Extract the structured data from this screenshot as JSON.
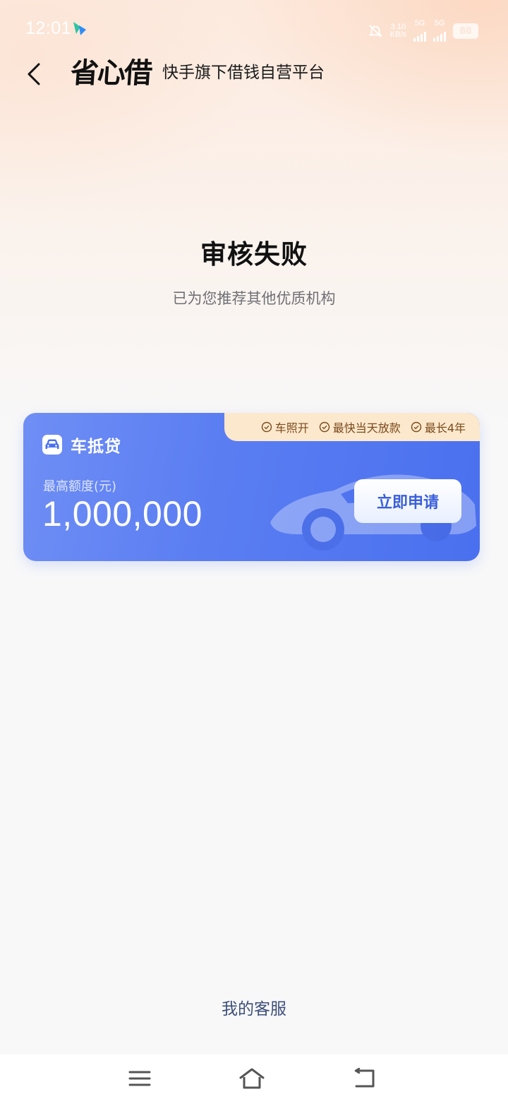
{
  "status_bar": {
    "time": "12:01",
    "network_top": "3.10",
    "network_bottom": "KB/s",
    "network_type": "5G",
    "battery": "88"
  },
  "header": {
    "logo_text": "省心借",
    "slogan": "快手旗下借钱自营平台"
  },
  "result": {
    "title": "审核失败",
    "subtitle": "已为您推荐其他优质机构"
  },
  "loan_card": {
    "tags": [
      "车照开",
      "最快当天放款",
      "最长4年"
    ],
    "product_name": "车抵贷",
    "limit_label": "最高额度(元)",
    "limit_amount": "1,000,000",
    "apply_label": "立即申请"
  },
  "footer": {
    "service_label": "我的客服"
  },
  "icons": {
    "back": "chevron-left-icon",
    "product": "car-icon",
    "tag": "check-circle-icon",
    "nav_menu": "menu-icon",
    "nav_home": "home-icon",
    "nav_back": "return-icon"
  },
  "colors": {
    "card_blue": "#4a70ef",
    "tag_bg": "#fce8cc",
    "tag_text": "#7a4a1e",
    "button_text": "#3b5fd9"
  }
}
